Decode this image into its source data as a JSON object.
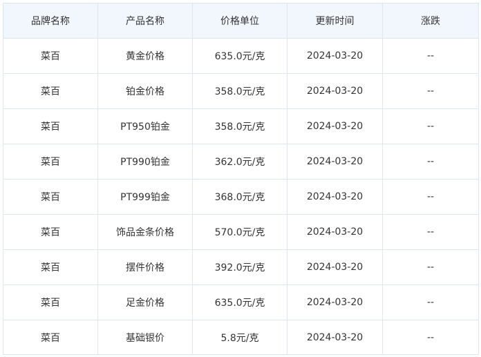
{
  "table": {
    "headers": [
      "品牌名称",
      "产品名称",
      "价格单位",
      "更新时间",
      "涨跌"
    ],
    "rows": [
      [
        "菜百",
        "黄金价格",
        "635.0元/克",
        "2024-03-20",
        "--"
      ],
      [
        "菜百",
        "铂金价格",
        "358.0元/克",
        "2024-03-20",
        "--"
      ],
      [
        "菜百",
        "PT950铂金",
        "358.0元/克",
        "2024-03-20",
        "--"
      ],
      [
        "菜百",
        "PT990铂金",
        "362.0元/克",
        "2024-03-20",
        "--"
      ],
      [
        "菜百",
        "PT999铂金",
        "368.0元/克",
        "2024-03-20",
        "--"
      ],
      [
        "菜百",
        "饰品金条价格",
        "570.0元/克",
        "2024-03-20",
        "--"
      ],
      [
        "菜百",
        "摆件价格",
        "392.0元/克",
        "2024-03-20",
        "--"
      ],
      [
        "菜百",
        "足金价格",
        "635.0元/克",
        "2024-03-20",
        "--"
      ],
      [
        "菜百",
        "基础银价",
        "5.8元/克",
        "2024-03-20",
        "--"
      ]
    ]
  }
}
